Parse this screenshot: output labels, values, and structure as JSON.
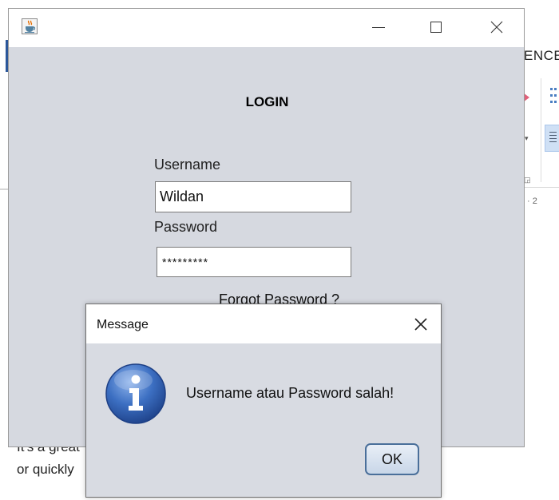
{
  "background": {
    "ribbon_text": "ENCE",
    "ruler_text": "· 2",
    "doc_line1": "It's a great",
    "doc_line2": "or quickly"
  },
  "login_window": {
    "title": "LOGIN",
    "username_label": "Username",
    "username_value": "Wildan",
    "password_label": "Password",
    "password_value": "*********",
    "forgot_password": "Forgot Password ?"
  },
  "dialog": {
    "title": "Message",
    "message": "Username atau Password salah!",
    "ok_label": "OK"
  },
  "colors": {
    "frame_bg": "#d6d9e0",
    "dialog_bg": "#d8dbe2",
    "word_accent": "#2b579a",
    "info_icon": "#2f5da8"
  },
  "icons": [
    "java-cup-icon",
    "minimize-icon",
    "maximize-icon",
    "close-icon",
    "info-icon"
  ]
}
